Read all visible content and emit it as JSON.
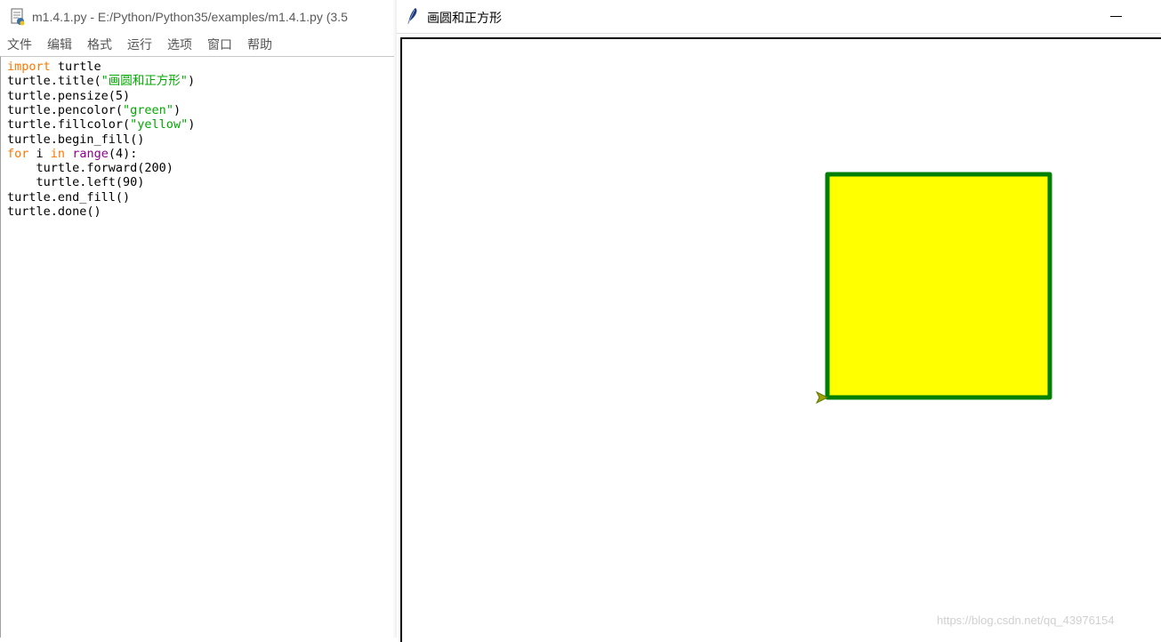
{
  "idle_window": {
    "title": "m1.4.1.py - E:/Python/Python35/examples/m1.4.1.py (3.5",
    "menu": [
      "文件",
      "编辑",
      "格式",
      "运行",
      "选项",
      "窗口",
      "帮助"
    ],
    "code": [
      [
        {
          "t": "import",
          "c": "kw"
        },
        {
          "t": " turtle"
        }
      ],
      [
        {
          "t": "turtle.title("
        },
        {
          "t": "\"画圆和正方形\"",
          "c": "str"
        },
        {
          "t": ")"
        }
      ],
      [
        {
          "t": "turtle.pensize(5)"
        }
      ],
      [
        {
          "t": "turtle.pencolor("
        },
        {
          "t": "\"green\"",
          "c": "str"
        },
        {
          "t": ")"
        }
      ],
      [
        {
          "t": "turtle.fillcolor("
        },
        {
          "t": "\"yellow\"",
          "c": "str"
        },
        {
          "t": ")"
        }
      ],
      [
        {
          "t": "turtle.begin_fill()"
        }
      ],
      [
        {
          "t": "for",
          "c": "kw"
        },
        {
          "t": " i "
        },
        {
          "t": "in",
          "c": "kw"
        },
        {
          "t": " "
        },
        {
          "t": "range",
          "c": "bi"
        },
        {
          "t": "(4):"
        }
      ],
      [
        {
          "t": "    turtle.forward(200)"
        }
      ],
      [
        {
          "t": "    turtle.left(90)"
        }
      ],
      [
        {
          "t": "turtle.end_fill()"
        }
      ],
      [
        {
          "t": "turtle.done()"
        }
      ]
    ]
  },
  "turtle_window": {
    "title": "画圆和正方形",
    "icon": "feather-icon",
    "drawing": {
      "square_fill": "#ffff00",
      "square_stroke": "#008000",
      "cursor_color": "#a0a000"
    }
  },
  "watermark": "https://blog.csdn.net/qq_43976154",
  "colors": {
    "keyword": "#ff7700",
    "string": "#00aa00",
    "builtin": "#900090"
  }
}
